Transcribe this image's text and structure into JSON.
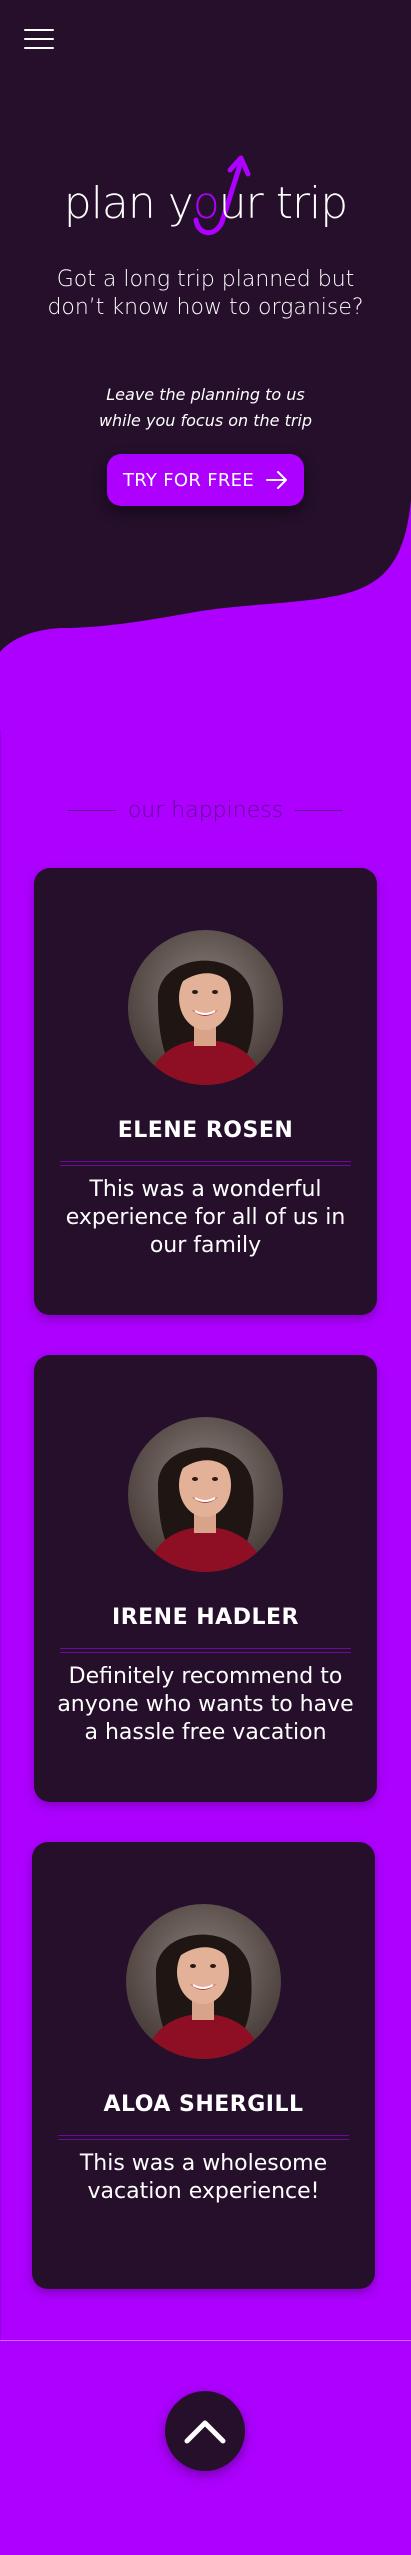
{
  "header": {
    "menu_icon": "hamburger-menu-icon"
  },
  "logo": {
    "prefix": "plan y",
    "o": "o",
    "suffix": "ur trip",
    "icon": "arrow-swoosh-icon"
  },
  "hero": {
    "tagline": "Got a long trip planned but don’t know how to organise?",
    "subtag_line1": "Leave the planning to us",
    "subtag_line2": "while you focus on the trip",
    "cta_label": "TRY FOR FREE",
    "cta_icon": "arrow-right-icon"
  },
  "testimonials": {
    "title": "our happiness",
    "items": [
      {
        "name": "ELENE ROSEN",
        "quote": "This was a wonderful experience for all of us in our family"
      },
      {
        "name": "IRENE HADLER",
        "quote": "Definitely recommend to anyone who wants to have a hassle free vacation"
      },
      {
        "name": "ALOA SHERGILL",
        "quote": "This was a wholesome vacation experience!"
      }
    ]
  },
  "footer": {
    "scroll_top_icon": "chevron-up-icon"
  },
  "colors": {
    "dark": "#250f2b",
    "accent": "#ad00ff"
  }
}
